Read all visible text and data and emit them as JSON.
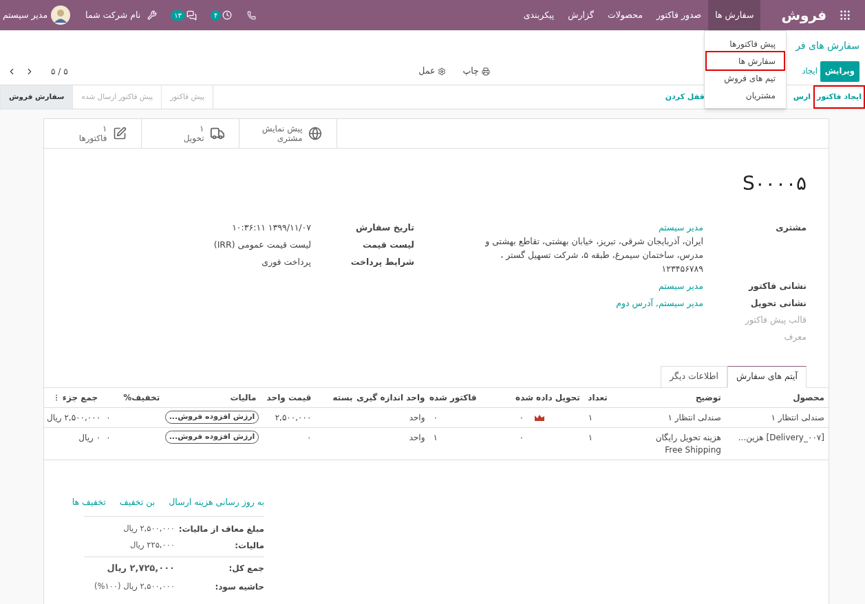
{
  "navbar": {
    "app_name": "فروش",
    "menu": [
      {
        "label": "سفارش ها",
        "selected": true
      },
      {
        "label": "صدور فاکتور",
        "selected": false
      },
      {
        "label": "محصولات",
        "selected": false
      },
      {
        "label": "گزارش",
        "selected": false
      },
      {
        "label": "پیکربندی",
        "selected": false
      }
    ],
    "activity_count": "۴",
    "message_count": "۱۳",
    "company": "نام شرکت شما",
    "user": "مدیر سیستم"
  },
  "dropdown": {
    "items": [
      {
        "label": "پیش فاکتورها",
        "highlighted": false
      },
      {
        "label": "سفارش ها",
        "highlighted": true
      },
      {
        "label": "تیم های فروش",
        "highlighted": false
      },
      {
        "label": "مشتریان",
        "highlighted": false
      }
    ]
  },
  "breadcrumb": "سفارش های فر",
  "edit_button": "ویرایش",
  "create_button": "ایجاد",
  "actions": [
    {
      "kind": "print",
      "label": "چاپ"
    },
    {
      "kind": "gear",
      "label": "عمل"
    }
  ],
  "pager": "۵ / ۵",
  "header_buttons": [
    {
      "label": "ایجاد فاکتور",
      "highlighted": true
    },
    {
      "label": "ارس",
      "highlighted": false
    },
    {
      "label": "قفل کردن",
      "highlighted": false
    }
  ],
  "status_steps": [
    {
      "label": "پیش فاکتور",
      "selected": false
    },
    {
      "label": "پیش فاکتور ارسال شده",
      "selected": false
    },
    {
      "label": "سفارش فروش",
      "selected": true
    }
  ],
  "smart_buttons": [
    {
      "kind": "preview",
      "label": "پیش نمایش مشتری"
    },
    {
      "kind": "delivery",
      "count": "۱",
      "label": "تحویل"
    },
    {
      "kind": "invoices",
      "count": "۱",
      "label": "فاکتورها"
    }
  ],
  "order_name": "S۰۰۰۰۵",
  "fields_right": [
    {
      "label": "مشتری",
      "kind": "bold",
      "value": "مدیر سیستم",
      "link": true,
      "extra": "ایران، آذربایجان شرقی، تبریز، خیابان بهشتی، تقاطع بهشتی و مدرس، ساختمان سیمرغ، طبقه ۵، شرکت تسهیل گستر ، ۱۲۳۴۵۶۷۸۹"
    },
    {
      "label": "نشانی فاکتور",
      "kind": "bold",
      "value": "مدیر سیستم",
      "link": true
    },
    {
      "label": "نشانی تحویل",
      "kind": "bold",
      "value": "مدیر سیستم, آدرس دوم",
      "link": true
    },
    {
      "label": "قالب پیش فاکتور",
      "kind": "muted"
    },
    {
      "label": "معرف",
      "kind": "muted"
    }
  ],
  "fields_left": [
    {
      "label": "تاریخ سفارش",
      "kind": "bold",
      "value": "۱۳۹۹/۱۱/۰۷ ۱۰:۳۶:۱۱",
      "link": false
    },
    {
      "label": "لیست قیمت",
      "kind": "bold",
      "value": "لیست قیمت عمومی (IRR)",
      "link": false
    },
    {
      "label": "شرایط پرداخت",
      "kind": "bold",
      "value": "پرداخت فوری",
      "link": false
    }
  ],
  "tabs": [
    {
      "label": "آیتم های سفارش",
      "selected": true
    },
    {
      "label": "اطلاعات دیگر",
      "selected": false
    }
  ],
  "table": {
    "columns": [
      "محصول",
      "توضیح",
      "تعداد",
      "تحویل داده شده",
      "فاکتور شده",
      "واحد اندازه گیری",
      "بسته",
      "قیمت واحد",
      "مالیات",
      "تخفیف%",
      "جمع جزء"
    ],
    "rows": [
      {
        "product": "صندلی انتظار ۱",
        "description": [
          "صندلی انتظار ۱"
        ],
        "quantity": "۱",
        "delivered": "۰",
        "forecast": true,
        "invoiced": "۰",
        "uom": "واحد",
        "unit_price": "۲,۵۰۰,۰۰۰",
        "tax": "ارزش افزوده فروش...",
        "discount": "۰",
        "subtotal": "۲,۵۰۰,۰۰۰ ریال"
      },
      {
        "product": "[Delivery_۰۰۷] هزین...",
        "description": [
          "هزینه تحویل رایگان",
          "Free Shipping"
        ],
        "quantity": "۱",
        "delivered": "۰",
        "forecast": false,
        "invoiced": "۱",
        "uom": "واحد",
        "unit_price": "۰",
        "tax": "ارزش افزوده فروش...",
        "discount": "۰",
        "subtotal": "۰ ریال"
      }
    ]
  },
  "footer_links": [
    "به روز رسانی هزینه ارسال",
    "بن تخفیف",
    "تخفیف ها"
  ],
  "totals": [
    {
      "label": "مبلغ معاف از مالیات:",
      "value": "۲,۵۰۰,۰۰۰ ریال",
      "kind": "normal"
    },
    {
      "label": "مالیات:",
      "value": "۲۲۵,۰۰۰ ریال",
      "kind": "normal"
    },
    {
      "label": "جمع کل:",
      "value": "۲,۷۲۵,۰۰۰ ریال",
      "kind": "grand"
    },
    {
      "label": "حاشیه سود:",
      "value": "۲,۵۰۰,۰۰۰ ریال (۱۰۰%)",
      "kind": "normal"
    }
  ]
}
